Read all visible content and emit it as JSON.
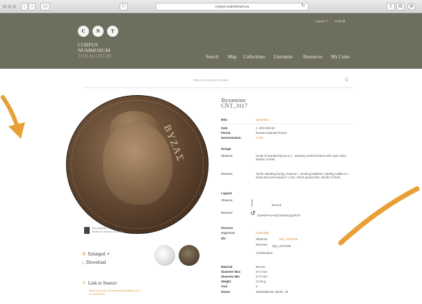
{
  "browser": {
    "url": "corpus-nummorum.eu"
  },
  "site": {
    "logo_letters": [
      "C",
      "N",
      "T"
    ],
    "logo_line1": "CORPUS",
    "logo_line2": "NUMMORUM",
    "logo_line3": "THRACORUM",
    "nav": [
      "Search",
      "Map",
      "Collections",
      "Literature",
      "Resources",
      "My Coins"
    ],
    "login": "Logout ⏎",
    "help": "Help ❂"
  },
  "page": {
    "back_link": "Return to Search Results",
    "museum_name": "Münzkabinett",
    "museum_sub": "Staatliche Museen zu Berlin",
    "enlarged": "Enlarged",
    "download": "Download",
    "link_to_source": "Link to Source:",
    "source_url": "http://ww2.smb.museum/ikmk/object.php?id=18202000"
  },
  "coin": {
    "legend_text": "ΒΥΖΑΣ",
    "title_line1": "Byzantion",
    "title_line2": "CNT_3117",
    "fields": {
      "mint_label": "Mint",
      "mint_value": "Byzantion",
      "date_label": "Date",
      "date_value": "c. 202-235 AD",
      "period_label": "Period",
      "period_value": "Roman Imperial Period",
      "denomination_label": "Denomination",
      "denomination_value": "3 unit",
      "design_label": "Design",
      "obverse_label": "Obverse:",
      "obverse_value": "Head of bearded Byzas to r., wearing crested helmet with open visor. Border of dots.",
      "reverse_label": "Reverse:",
      "reverse_value": "Tyche standing facing, head to l., wearing kalathos, holding rudder in r. hand and cornucopia in l. arm. Short ground line. Border of dots.",
      "legend_label": "Legend",
      "legend_obverse_label": "Obverse:",
      "legend_obverse_value": "ΒΥΖΑΣ",
      "legend_reverse_label": "Reverse:",
      "legend_reverse_value": "ΕΠΙ•ΚΡ•ΑΥ•ΑΚΟΤΜΗΝΟΔΟΡΟΥ",
      "persons_label": "Persons",
      "magistrate_label": "Magistrate",
      "magistrate_value": "Caracalla",
      "die_label": "Die",
      "die_obverse_label": "Obverse:",
      "die_obverse_value": "Byz_2072103",
      "die_reverse_label": "Reverse:",
      "die_reverse_value": "Byz_2072105",
      "die_combination": "Combination",
      "material_label": "Material",
      "material_value": "Bronze",
      "diam_max_label": "Diameter Max",
      "diam_max_value": "27.0 mm",
      "diam_min_label": "Diameter Min",
      "diam_min_value": "27.0 mm",
      "weight_label": "Weight",
      "weight_value": "12.36 g",
      "axis_label": "Axis",
      "axis_value": "6",
      "owner_label": "Owner",
      "owner_value": "Münzkabinett, Berlin, 18"
    }
  },
  "colors": {
    "header_bg": "#6e6e5e",
    "accent_orange": "#e8a036"
  }
}
